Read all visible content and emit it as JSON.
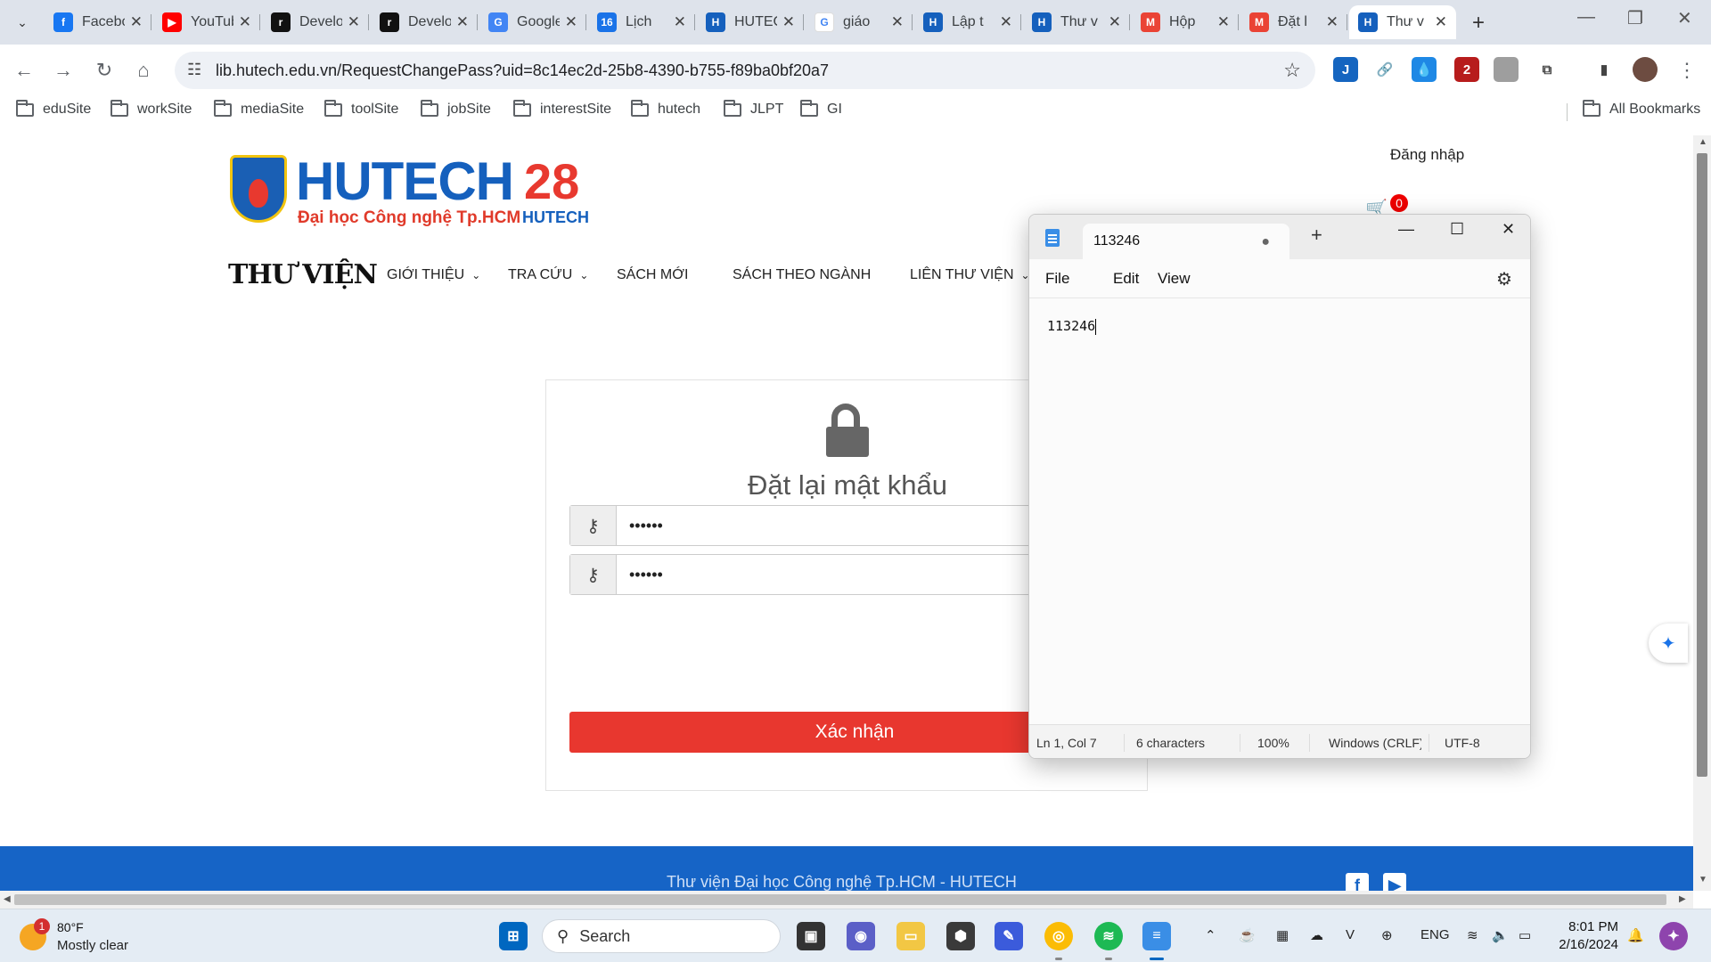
{
  "browser": {
    "tabs": [
      {
        "title": "Facebook",
        "favicon": "facebook-icon",
        "color": "#1877f2",
        "glyph": "f"
      },
      {
        "title": "YouTube",
        "favicon": "youtube-icon",
        "color": "#ff0000",
        "glyph": "▶"
      },
      {
        "title": "Developer",
        "favicon": "dev-icon",
        "color": "#111111",
        "glyph": "r"
      },
      {
        "title": "Developer",
        "favicon": "dev-icon",
        "color": "#111111",
        "glyph": "r"
      },
      {
        "title": "Google",
        "favicon": "google-translate-icon",
        "color": "#4285f4",
        "glyph": "G"
      },
      {
        "title": "Lịch",
        "favicon": "calendar-icon",
        "color": "#1a73e8",
        "glyph": "16"
      },
      {
        "title": "HUTECH",
        "favicon": "hutech-icon",
        "color": "#1560bd",
        "glyph": "H"
      },
      {
        "title": "giáo",
        "favicon": "google-icon",
        "color": "#ffffff",
        "glyph": "G"
      },
      {
        "title": "Lập t",
        "favicon": "hutech-icon",
        "color": "#1560bd",
        "glyph": "H"
      },
      {
        "title": "Thư v",
        "favicon": "hutech-icon",
        "color": "#1560bd",
        "glyph": "H"
      },
      {
        "title": "Hộp",
        "favicon": "gmail-icon",
        "color": "#ea4335",
        "glyph": "M"
      },
      {
        "title": "Đặt l",
        "favicon": "gmail-icon",
        "color": "#ea4335",
        "glyph": "M"
      },
      {
        "title": "Thư v",
        "favicon": "hutech-icon",
        "color": "#1560bd",
        "glyph": "H",
        "active": true
      }
    ],
    "url": "lib.hutech.edu.vn/RequestChangePass?uid=8c14ec2d-25b8-4390-b755-f89ba0bf20a7",
    "extensions": [
      {
        "name": "ext-j-icon",
        "color": "#1565c0",
        "glyph": "J"
      },
      {
        "name": "link-icon",
        "color": "#ffffff",
        "glyph": "🔗"
      },
      {
        "name": "drop-icon",
        "color": "#1e88e5",
        "glyph": "💧"
      },
      {
        "name": "ublock-icon",
        "color": "#b71c1c",
        "glyph": "2"
      },
      {
        "name": "ext-grey-icon",
        "color": "#9e9e9e",
        "glyph": ""
      },
      {
        "name": "puzzle-icon",
        "color": "#ffffff",
        "glyph": "⧉"
      },
      {
        "name": "sidepanel-icon",
        "color": "#ffffff",
        "glyph": "▮"
      },
      {
        "name": "profile-avatar",
        "color": "#6d4c41",
        "glyph": ""
      }
    ],
    "bookmarks": [
      "eduSite",
      "workSite",
      "mediaSite",
      "toolSite",
      "jobSite",
      "interestSite",
      "hutech",
      "JLPT",
      "GI"
    ],
    "all_bookmarks": "All Bookmarks"
  },
  "site": {
    "logo_main": "HUTECH",
    "logo_sub": "Đại học Công nghệ Tp.HCM",
    "logo_28": "28",
    "logo_28_sub": "HUTECH",
    "login": "Đăng nhập",
    "cart_count": "0",
    "brand": "THƯ VIỆN",
    "nav": [
      {
        "label": "GIỚI THIỆU",
        "dropdown": true
      },
      {
        "label": "TRA CỨU",
        "dropdown": true
      },
      {
        "label": "SÁCH MỚI",
        "dropdown": false
      },
      {
        "label": "SÁCH THEO NGÀNH",
        "dropdown": false
      },
      {
        "label": "LIÊN THƯ VIỆN",
        "dropdown": true
      }
    ],
    "reset": {
      "title": "Đặt lại mật khẩu",
      "password1": "••••••",
      "password2": "••••••",
      "submit": "Xác nhận"
    },
    "footer_text": "Thư viện Đại học Công nghệ Tp.HCM - HUTECH",
    "accent": "#e8372f",
    "footer_color": "#1664c6"
  },
  "notepad": {
    "tab_title": "113246",
    "menu": [
      "File",
      "Edit",
      "View"
    ],
    "content": "113246",
    "status": {
      "position": "Ln 1, Col 7",
      "chars": "6 characters",
      "zoom": "100%",
      "eol": "Windows (CRLF)",
      "encoding": "UTF-8"
    }
  },
  "taskbar": {
    "weather_temp": "80°F",
    "weather_cond": "Mostly clear",
    "weather_badge": "1",
    "search": "Search",
    "lang": "ENG",
    "time": "8:01 PM",
    "date": "2/16/2024"
  }
}
